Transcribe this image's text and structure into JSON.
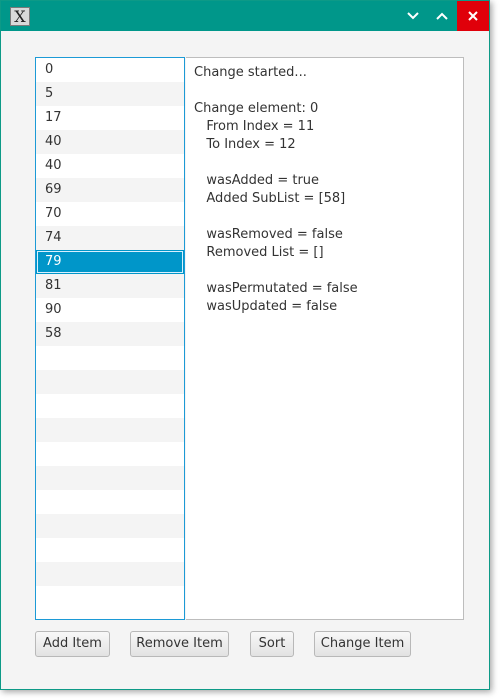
{
  "titlebar": {
    "app_icon_glyph": "X",
    "controls": {
      "minimize": "minimize-icon",
      "maximize": "maximize-icon",
      "close": "close-icon"
    }
  },
  "list": {
    "items": [
      "0",
      "5",
      "17",
      "40",
      "40",
      "69",
      "70",
      "74",
      "79",
      "81",
      "90",
      "58"
    ],
    "selected_index": 8,
    "selection_color": "#0096c9"
  },
  "log": {
    "lines": [
      "Change started...",
      "",
      "Change element: 0",
      "   From Index = 11",
      "   To Index = 12",
      "",
      "   wasAdded = true",
      "   Added SubList = [58]",
      "",
      "   wasRemoved = false",
      "   Removed List = []",
      "",
      "   wasPermutated = false",
      "   wasUpdated = false"
    ]
  },
  "buttons": {
    "add": "Add Item",
    "remove": "Remove Item",
    "sort": "Sort",
    "change": "Change Item"
  },
  "colors": {
    "titlebar": "#00978a",
    "close": "#e0000a",
    "list_border": "#1c9ad6"
  }
}
